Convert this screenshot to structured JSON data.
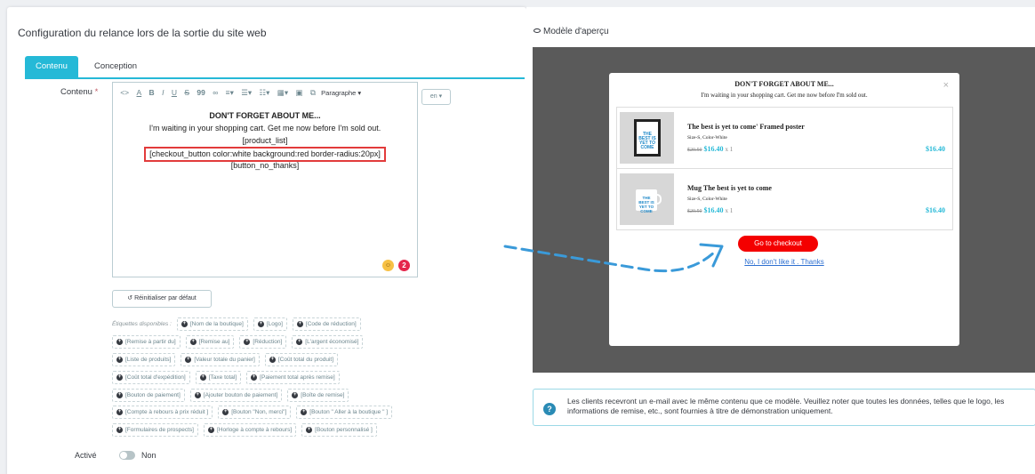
{
  "config": {
    "title": "Configuration du relance lors de la sortie du site web",
    "tabs": [
      {
        "label": "Contenu",
        "active": true
      },
      {
        "label": "Conception",
        "active": false
      }
    ],
    "content_label": "Contenu",
    "required_mark": "*",
    "toolbar": {
      "items": [
        "<>",
        "A",
        "A",
        "B",
        "I",
        "U",
        "S",
        "99",
        "∞",
        "≡▾",
        "☰▾",
        "☷▾",
        "▦▾",
        "▣",
        "⧉"
      ],
      "paragraph": "Paragraphe ▾"
    },
    "language": "en ▾",
    "editor": {
      "title": "DON'T FORGET ABOUT ME...",
      "message": "I'm waiting in your shopping cart. Get me now before I'm sold out.",
      "product_list": "[product_list]",
      "checkout_button": "[checkout_button color:white background:red border-radius:20px]",
      "button_no_thanks": "[button_no_thanks]",
      "badge_count": "2"
    },
    "reset_label": "Réinitialiser par défaut",
    "tags_label": "Étiquettes disponibles :",
    "tag_rows": [
      [
        "[Nom de la boutique]",
        "[Logo]",
        "[Code de réduction]"
      ],
      [
        "[Remise à partir du]",
        "[Remise au]",
        "[Réduction]",
        "[L'argent économisé]"
      ],
      [
        "[Liste de produits]",
        "[Valeur totale du panier]",
        "[Coût total du produit]"
      ],
      [
        "[Coût total d'expédition]",
        "[Taxe total]",
        "[Paiement total après remise]"
      ],
      [
        "[Bouton de paiement]",
        "[Ajouter bouton de paiement]",
        "[Boîte de remise]"
      ],
      [
        "[Compte à rebours à prix réduit ]",
        "[Bouton \"Non, merci\"]",
        "[Bouton \" Aller à la boutique \" ]"
      ],
      [
        "[Formulaires de prospects]",
        "[Horloge à compte à rebours]",
        "[Bouton personnalisé ]"
      ]
    ],
    "active_label": "Activé",
    "active_value": "Non"
  },
  "preview": {
    "title": "Modèle d'aperçu",
    "modal": {
      "title": "DON'T FORGET ABOUT ME...",
      "subtitle": "I'm waiting in your shopping cart. Get me now before I'm sold out.",
      "close": "×",
      "products": [
        {
          "name": "The best is yet to come' Framed poster",
          "variant": "Size-S, Color-White",
          "old_price": "$20.50",
          "price": "$16.40",
          "qty": "x 1",
          "total": "$16.40",
          "thumb_text": "THE BEST IS YET TO COME"
        },
        {
          "name": "Mug The best is yet to come",
          "variant": "Size-S, Color-White",
          "old_price": "$20.50",
          "price": "$16.40",
          "qty": "x 1",
          "total": "$16.40",
          "thumb_text": "THE BEST IS YET TO COME"
        }
      ],
      "checkout_label": "Go to checkout",
      "no_thanks_label": "No, I don't like it . Thanks"
    },
    "info": "Les clients recevront un e-mail avec le même contenu que ce modèle. Veuillez noter que toutes les données, telles que le logo, les informations de remise, etc., sont fournies à titre de démonstration uniquement.",
    "info_icon": "?"
  },
  "colors": {
    "accent": "#25b9d7",
    "checkout": "#f40000",
    "highlight_border": "#e23b3b",
    "arrow": "#3a9ad9"
  }
}
